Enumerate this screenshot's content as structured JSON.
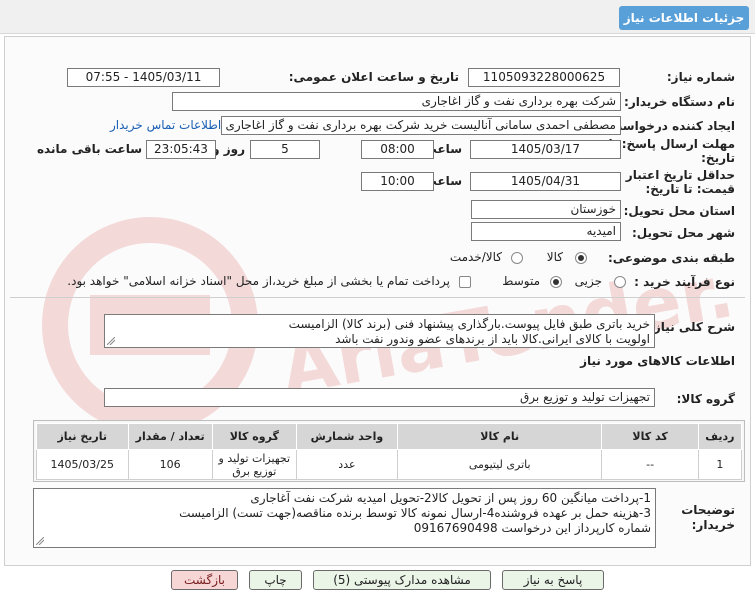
{
  "window": {
    "title": "جزئیات اطلاعات نیاز"
  },
  "form": {
    "need_number": {
      "label": "شماره نیاز:",
      "value": "1105093228000625"
    },
    "announce_datetime": {
      "label": "تاریخ و ساعت اعلان عمومی:",
      "value": "1405/03/11 - 07:55"
    },
    "buyer_org": {
      "label": "نام دستگاه خریدار:",
      "value": "شرکت بهره برداری نفت و گاز اغاجاری"
    },
    "creator": {
      "label": "ایجاد کننده درخواست:",
      "value": "مصطفی احمدی سامانی آنالیست خرید شرکت بهره برداری نفت و گاز اغاجاری",
      "contact_link": "اطلاعات تماس خریدار"
    },
    "reply_deadline": {
      "label_line1": "مهلت ارسال پاسخ: تا",
      "label_line2": "تاریخ:",
      "date": "1405/03/17",
      "time_label": "ساعت",
      "time": "08:00",
      "days": "5",
      "days_label": "روز و",
      "remaining": "23:05:43",
      "remaining_label": "ساعت باقی مانده"
    },
    "price_validity": {
      "label_line1": "حداقل تاریخ اعتبار",
      "label_line2": "قیمت: تا تاریخ:",
      "date": "1405/04/31",
      "time_label": "ساعت",
      "time": "10:00"
    },
    "province": {
      "label": "استان محل تحویل:",
      "value": "خوزستان"
    },
    "city": {
      "label": "شهر محل تحویل:",
      "value": "امیدیه"
    },
    "category": {
      "label": "طبقه بندی موضوعی:",
      "options": [
        "کالا",
        "کالا/خدمت"
      ],
      "selected": "کالا"
    },
    "process_type": {
      "label": "نوع فرآیند خرید :",
      "options": [
        "جزیی",
        "متوسط"
      ],
      "selected": "متوسط",
      "note": "پرداخت تمام یا بخشی از مبلغ خرید،از محل \"اسناد خزانه اسلامی\" خواهد بود."
    },
    "general_description": {
      "label": "شرح کلی نیاز:",
      "line1": "خرید باتری طبق فایل پیوست.بارگذاری پیشنهاد فنی (برند کالا) الزامیست",
      "line2": "اولویت با کالای ایرانی.کالا باید از برندهای عضو وندور نفت باشد"
    }
  },
  "goods": {
    "section_title": "اطلاعات کالاهای مورد نیاز",
    "group_label": "گروه کالا:",
    "group_value": "تجهیزات تولید و توزیع برق",
    "columns": [
      "ردیف",
      "کد کالا",
      "نام کالا",
      "واحد شمارش",
      "گروه کالا",
      "تعداد / مقدار",
      "تاریخ نیاز"
    ],
    "rows": [
      {
        "row": "1",
        "code": "--",
        "name": "باتری لیتیومی",
        "unit": "عدد",
        "group": "تجهیزات تولید و توزیع برق",
        "qty": "106",
        "date": "1405/03/25"
      }
    ]
  },
  "buyer_notes": {
    "label_line1": "توضیحات",
    "label_line2": "خریدار:",
    "line1": "1-پرداخت میانگین 60 روز پس از تحویل کالا2-تحویل امیدیه شرکت نفت آغاجاری",
    "line2": "3-هزینه حمل بر عهده فروشنده4-ارسال نمونه کالا توسط برنده مناقصه(جهت تست) الزامیست",
    "line3": "شماره کارپرداز این درخواست 09167690498"
  },
  "buttons": {
    "reply": "پاسخ به نیاز",
    "attachments": "مشاهده مدارک پیوستی (5)",
    "print": "چاپ",
    "back": "بازگشت"
  },
  "watermark": {
    "text": "AriaTender.net"
  },
  "colors": {
    "title_accent": "#5aa0d8",
    "link": "#1a5fb4",
    "back_button": "#f7d6d6",
    "action_button": "#eaf5e8"
  }
}
